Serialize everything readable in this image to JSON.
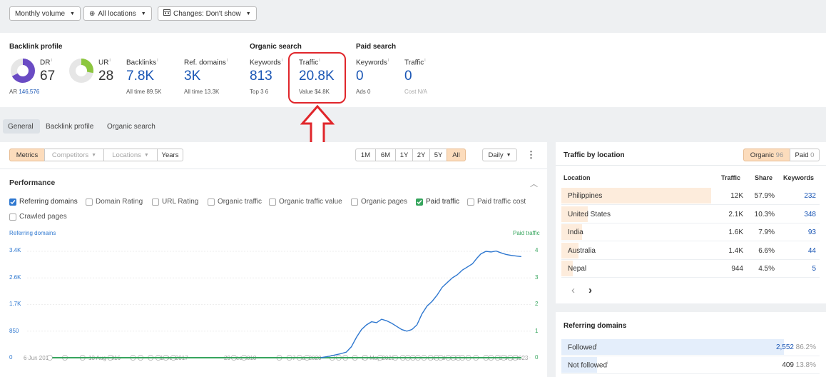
{
  "toolbar": {
    "monthly_volume": "Monthly volume",
    "all_locations": "All locations",
    "changes": "Changes: Don't show"
  },
  "overview": {
    "backlink_profile": "Backlink profile",
    "organic_search": "Organic search",
    "paid_search": "Paid search",
    "dr": {
      "label": "DR",
      "value": "67",
      "ring_fill": 0.67
    },
    "ur": {
      "label": "UR",
      "value": "28",
      "ring_fill": 0.28
    },
    "ar": {
      "label": "AR",
      "value": "146,576"
    },
    "backlinks": {
      "label": "Backlinks",
      "value": "7.8K",
      "sub": "All time 89.5K"
    },
    "ref_domains": {
      "label": "Ref. domains",
      "value": "3K",
      "sub": "All time 13.3K"
    },
    "org_keywords": {
      "label": "Keywords",
      "value": "813",
      "sub": "Top 3 6"
    },
    "org_traffic": {
      "label": "Traffic",
      "value": "20.8K",
      "sub": "Value $4.8K"
    },
    "paid_keywords": {
      "label": "Keywords",
      "value": "0",
      "sub": "Ads 0"
    },
    "paid_traffic": {
      "label": "Traffic",
      "value": "0",
      "sub": "Cost N/A"
    },
    "info": "i"
  },
  "tabs": [
    "General",
    "Backlink profile",
    "Organic search"
  ],
  "chart_toolbar": {
    "metrics": "Metrics",
    "competitors": "Competitors",
    "locations": "Locations",
    "years": "Years",
    "ranges": [
      "1M",
      "6M",
      "1Y",
      "2Y",
      "5Y",
      "All"
    ],
    "interval": "Daily",
    "more": "⋮"
  },
  "performance": {
    "title": "Performance",
    "checkboxes": [
      {
        "label": "Referring domains",
        "checked": true,
        "color": "#2f78d0"
      },
      {
        "label": "Domain Rating",
        "checked": false
      },
      {
        "label": "URL Rating",
        "checked": false
      },
      {
        "label": "Organic traffic",
        "checked": false
      },
      {
        "label": "Organic traffic value",
        "checked": false
      },
      {
        "label": "Organic pages",
        "checked": false
      },
      {
        "label": "Paid traffic",
        "checked": true,
        "color": "#36a55d"
      },
      {
        "label": "Paid traffic cost",
        "checked": false
      },
      {
        "label": "Crawled pages",
        "checked": false
      }
    ]
  },
  "chart_data": {
    "type": "line",
    "title": "",
    "left_axis_label": "Referring domains",
    "right_axis_label": "Paid traffic",
    "y_ticks": [
      "3.4K",
      "2.6K",
      "1.7K",
      "850",
      "0"
    ],
    "y2_ticks": [
      "4",
      "3",
      "2",
      "1",
      "0"
    ],
    "x_ticks": [
      "6 Jun 2015",
      "13 Aug 2016",
      "21 Oct 2017",
      "29 Dec 2018",
      "7 Mar 2020",
      "15 May 2021",
      "23 Jul 2022",
      "30 Sep 2023"
    ],
    "ylim": [
      0,
      3400
    ],
    "y2lim": [
      0,
      4
    ],
    "series": [
      {
        "name": "Referring domains",
        "color": "#2f78d0",
        "points": [
          [
            0.582,
            0
          ],
          [
            0.6,
            50
          ],
          [
            0.62,
            120
          ],
          [
            0.633,
            180
          ],
          [
            0.643,
            350
          ],
          [
            0.653,
            650
          ],
          [
            0.663,
            900
          ],
          [
            0.673,
            1050
          ],
          [
            0.683,
            1150
          ],
          [
            0.693,
            1120
          ],
          [
            0.703,
            1230
          ],
          [
            0.713,
            1180
          ],
          [
            0.723,
            1100
          ],
          [
            0.733,
            1000
          ],
          [
            0.743,
            900
          ],
          [
            0.753,
            850
          ],
          [
            0.763,
            900
          ],
          [
            0.773,
            1050
          ],
          [
            0.783,
            1400
          ],
          [
            0.793,
            1650
          ],
          [
            0.803,
            1800
          ],
          [
            0.813,
            2000
          ],
          [
            0.823,
            2250
          ],
          [
            0.833,
            2400
          ],
          [
            0.843,
            2550
          ],
          [
            0.853,
            2650
          ],
          [
            0.863,
            2800
          ],
          [
            0.873,
            2900
          ],
          [
            0.883,
            3000
          ],
          [
            0.893,
            3200
          ],
          [
            0.9,
            3320
          ],
          [
            0.91,
            3400
          ],
          [
            0.92,
            3380
          ],
          [
            0.93,
            3410
          ],
          [
            0.94,
            3350
          ],
          [
            0.95,
            3300
          ],
          [
            0.96,
            3270
          ],
          [
            0.97,
            3250
          ],
          [
            0.98,
            3230
          ]
        ]
      },
      {
        "name": "Paid traffic",
        "color": "#36a55d",
        "points": [
          [
            0.05,
            0
          ],
          [
            0.98,
            0
          ]
        ]
      }
    ]
  },
  "traffic_by_location": {
    "title": "Traffic by location",
    "organic_label": "Organic",
    "organic_count": "96",
    "paid_label": "Paid",
    "paid_count": "0",
    "columns": [
      "Location",
      "Traffic",
      "Share",
      "Keywords"
    ],
    "rows": [
      {
        "location": "Philippines",
        "traffic": "12K",
        "share": "57.9%",
        "keywords": "232",
        "fill": 0.579
      },
      {
        "location": "United States",
        "traffic": "2.1K",
        "share": "10.3%",
        "keywords": "348",
        "fill": 0.103
      },
      {
        "location": "India",
        "traffic": "1.6K",
        "share": "7.9%",
        "keywords": "93",
        "fill": 0.079
      },
      {
        "location": "Australia",
        "traffic": "1.4K",
        "share": "6.6%",
        "keywords": "44",
        "fill": 0.066
      },
      {
        "location": "Nepal",
        "traffic": "944",
        "share": "4.5%",
        "keywords": "5",
        "fill": 0.045
      }
    ],
    "prev": "‹",
    "next": "›"
  },
  "referring_domains": {
    "title": "Referring domains",
    "rows": [
      {
        "label": "Followed",
        "value": "2,552",
        "pct": "86.2%",
        "fill": 0.862
      },
      {
        "label": "Not followed",
        "value": "409",
        "pct": "13.8%",
        "fill": 0.138
      }
    ]
  },
  "colors": {
    "accent_blue": "#1a56b5",
    "highlight_red": "#e0262b",
    "orange_active": "#fcdcbc"
  }
}
